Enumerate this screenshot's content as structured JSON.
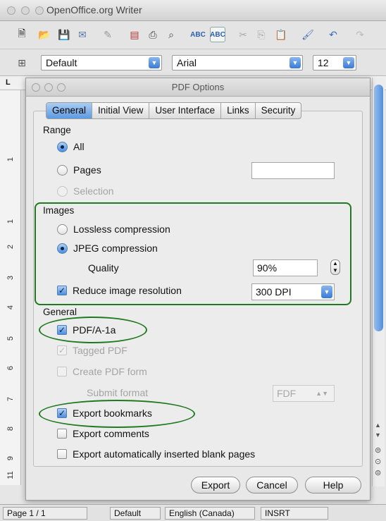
{
  "window": {
    "title": "OpenOffice.org Writer"
  },
  "toolbar": {
    "paragraph_style": "Default",
    "font_name": "Arial",
    "font_size": "12"
  },
  "ruler": {
    "numbers": [
      "1",
      "1",
      "2",
      "3",
      "4",
      "5",
      "6",
      "7",
      "8",
      "9",
      "11"
    ]
  },
  "dialog": {
    "title": "PDF Options",
    "tabs": [
      "General",
      "Initial View",
      "User Interface",
      "Links",
      "Security"
    ],
    "active_tab": "General",
    "range": {
      "label": "Range",
      "all": "All",
      "pages": "Pages",
      "pages_value": "",
      "selection": "Selection",
      "selected": "All"
    },
    "images": {
      "label": "Images",
      "lossless": "Lossless compression",
      "jpeg": "JPEG compression",
      "selected": "JPEG compression",
      "quality_label": "Quality",
      "quality_value": "90%",
      "reduce_label": "Reduce image resolution",
      "reduce_checked": true,
      "resolution": "300 DPI"
    },
    "general": {
      "label": "General",
      "pdfa": "PDF/A-1a",
      "pdfa_checked": true,
      "tagged": "Tagged PDF",
      "tagged_checked": true,
      "create_form": "Create PDF form",
      "create_form_checked": false,
      "submit_format_label": "Submit format",
      "submit_format_value": "FDF",
      "export_bookmarks": "Export bookmarks",
      "export_bookmarks_checked": true,
      "export_comments": "Export comments",
      "export_comments_checked": false,
      "export_blank": "Export automatically inserted blank pages",
      "export_blank_checked": false
    },
    "buttons": {
      "export": "Export",
      "cancel": "Cancel",
      "help": "Help"
    },
    "highlight_color": "#207a1f"
  },
  "statusbar": {
    "page": "Page 1 / 1",
    "style": "Default",
    "language": "English (Canada)",
    "mode": "INSRT"
  },
  "colors": {
    "accent": "#4c8de0",
    "highlight": "#207a1f"
  }
}
